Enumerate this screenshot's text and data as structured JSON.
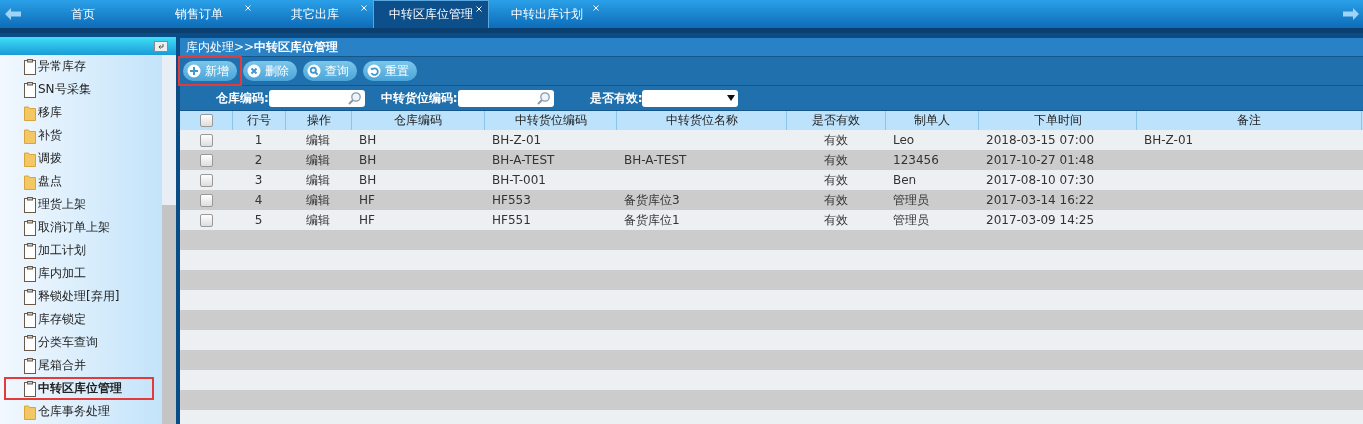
{
  "tabs": [
    {
      "label": "首页",
      "selected": false,
      "closable": false
    },
    {
      "label": "销售订单",
      "selected": false,
      "closable": true
    },
    {
      "label": "其它出库",
      "selected": false,
      "closable": true
    },
    {
      "label": "中转区库位管理",
      "selected": true,
      "closable": true
    },
    {
      "label": "中转出库计划",
      "selected": false,
      "closable": true
    }
  ],
  "sidebar": {
    "items": [
      {
        "label": "异常库存",
        "kind": "page",
        "selected": false
      },
      {
        "label": "SN号采集",
        "kind": "page",
        "selected": false
      },
      {
        "label": "移库",
        "kind": "folder",
        "selected": false
      },
      {
        "label": "补货",
        "kind": "folder",
        "selected": false
      },
      {
        "label": "调拨",
        "kind": "folder",
        "selected": false
      },
      {
        "label": "盘点",
        "kind": "folder",
        "selected": false
      },
      {
        "label": "理货上架",
        "kind": "page",
        "selected": false
      },
      {
        "label": "取消订单上架",
        "kind": "page",
        "selected": false
      },
      {
        "label": "加工计划",
        "kind": "page",
        "selected": false
      },
      {
        "label": "库内加工",
        "kind": "page",
        "selected": false
      },
      {
        "label": "释锁处理[弃用]",
        "kind": "page",
        "selected": false
      },
      {
        "label": "库存锁定",
        "kind": "page",
        "selected": false
      },
      {
        "label": "分类车查询",
        "kind": "page",
        "selected": false
      },
      {
        "label": "尾箱合并",
        "kind": "page",
        "selected": false
      },
      {
        "label": "中转区库位管理",
        "kind": "page",
        "selected": true
      },
      {
        "label": "仓库事务处理",
        "kind": "folder",
        "selected": false
      }
    ]
  },
  "breadcrumb": {
    "path": "库内处理>>",
    "current": "中转区库位管理"
  },
  "toolbar": [
    {
      "label": "新增",
      "kind": "add",
      "highlighted": true
    },
    {
      "label": "删除",
      "kind": "delete",
      "highlighted": false
    },
    {
      "label": "查询",
      "kind": "search",
      "highlighted": false
    },
    {
      "label": "重置",
      "kind": "reset",
      "highlighted": false
    }
  ],
  "filters": [
    {
      "label": "仓库编码:",
      "kind": "search"
    },
    {
      "label": "中转货位编码:",
      "kind": "search"
    },
    {
      "label": "是否有效:",
      "kind": "select"
    }
  ],
  "table": {
    "header_checked": false,
    "columns": [
      "行号",
      "操作",
      "仓库编码",
      "中转货位编码",
      "中转货位名称",
      "是否有效",
      "制单人",
      "下单时间",
      "备注"
    ],
    "rows": [
      {
        "checked": false,
        "cells": [
          "1",
          "编辑",
          "BH",
          "BH-Z-01",
          "",
          "有效",
          "Leo",
          "2018-03-15 07:00",
          "BH-Z-01"
        ]
      },
      {
        "checked": false,
        "cells": [
          "2",
          "编辑",
          "BH",
          "BH-A-TEST",
          "BH-A-TEST",
          "有效",
          "123456",
          "2017-10-27 01:48",
          ""
        ]
      },
      {
        "checked": false,
        "cells": [
          "3",
          "编辑",
          "BH",
          "BH-T-001",
          "",
          "有效",
          "Ben",
          "2017-08-10 07:30",
          ""
        ]
      },
      {
        "checked": false,
        "cells": [
          "4",
          "编辑",
          "HF",
          "HF553",
          "备货库位3",
          "有效",
          "管理员",
          "2017-03-14 16:22",
          ""
        ]
      },
      {
        "checked": false,
        "cells": [
          "5",
          "编辑",
          "HF",
          "HF551",
          "备货库位1",
          "有效",
          "管理员",
          "2017-03-09 14:25",
          ""
        ]
      }
    ]
  }
}
